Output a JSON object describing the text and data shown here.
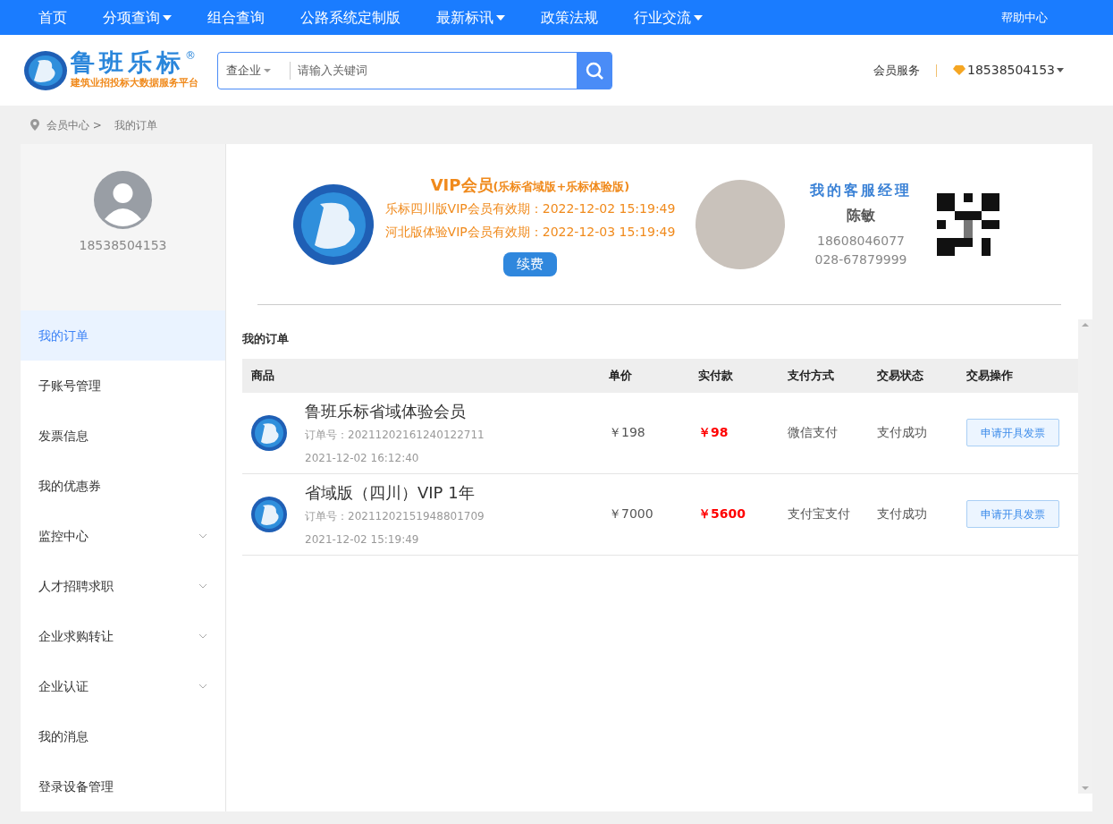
{
  "top_nav": {
    "items": [
      {
        "label": "首页",
        "has_menu": false
      },
      {
        "label": "分项查询",
        "has_menu": true
      },
      {
        "label": "组合查询",
        "has_menu": false
      },
      {
        "label": "公路系统定制版",
        "has_menu": false
      },
      {
        "label": "最新标讯",
        "has_menu": true
      },
      {
        "label": "政策法规",
        "has_menu": false
      },
      {
        "label": "行业交流",
        "has_menu": true
      }
    ],
    "help": "帮助中心"
  },
  "header": {
    "logo_name": "鲁班乐标",
    "logo_mark": "®",
    "logo_slogan": "建筑业招投标大数据服务平台",
    "search": {
      "scope": "查企业",
      "placeholder": "请输入关键词"
    },
    "member_service": "会员服务",
    "account": "18538504153"
  },
  "breadcrumb": [
    "会员中心 >",
    "我的订单"
  ],
  "sidebar": {
    "username": "18538504153",
    "items": [
      {
        "label": "我的订单",
        "selected": true,
        "expandable": false
      },
      {
        "label": "子账号管理",
        "selected": false,
        "expandable": false
      },
      {
        "label": "发票信息",
        "selected": false,
        "expandable": false
      },
      {
        "label": "我的优惠券",
        "selected": false,
        "expandable": false
      },
      {
        "label": "监控中心",
        "selected": false,
        "expandable": true
      },
      {
        "label": "人才招聘求职",
        "selected": false,
        "expandable": true
      },
      {
        "label": "企业求购转让",
        "selected": false,
        "expandable": true
      },
      {
        "label": "企业认证",
        "selected": false,
        "expandable": true
      },
      {
        "label": "我的消息",
        "selected": false,
        "expandable": false
      },
      {
        "label": "登录设备管理",
        "selected": false,
        "expandable": false
      }
    ]
  },
  "vip": {
    "title": "VIP会员",
    "subtitle": "(乐标省域版+乐标体验版)",
    "lines": [
      "乐标四川版VIP会员有效期：2022-12-02 15:19:49",
      "河北版体验VIP会员有效期：2022-12-03 15:19:49"
    ],
    "renew": "续费"
  },
  "manager": {
    "heading": "我的客服经理",
    "name": "陈敏",
    "phone": "18608046077",
    "tel": "028-67879999"
  },
  "orders": {
    "title": "我的订单",
    "columns": [
      "商品",
      "单价",
      "实付款",
      "支付方式",
      "交易状态",
      "交易操作"
    ],
    "rows": [
      {
        "product": "鲁班乐标省域体验会员",
        "order_no": "订单号：20211202161240122711",
        "time": "2021-12-02 16:12:40",
        "price": "￥198",
        "paid": "￥98",
        "method": "微信支付",
        "status": "支付成功",
        "action": "申请开具发票"
      },
      {
        "product": "省域版（四川）VIP 1年",
        "order_no": "订单号：20211202151948801709",
        "time": "2021-12-02 15:19:49",
        "price": "￥7000",
        "paid": "￥5600",
        "method": "支付宝支付",
        "status": "支付成功",
        "action": "申请开具发票"
      }
    ]
  }
}
